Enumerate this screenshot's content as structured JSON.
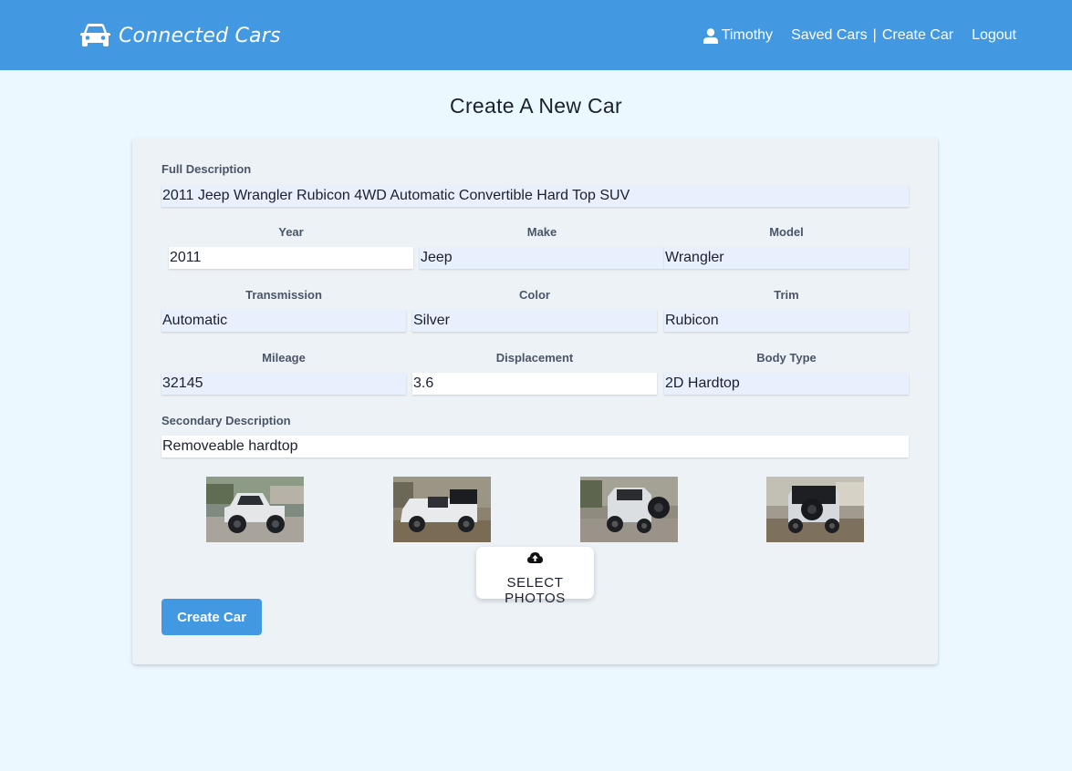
{
  "nav": {
    "brand": "Connected Cars",
    "user": "Timothy",
    "saved_cars": "Saved Cars",
    "separator": "|",
    "create_car": "Create Car",
    "logout": "Logout"
  },
  "page_title": "Create A New Car",
  "form": {
    "full_description": {
      "label": "Full Description",
      "value": "2011 Jeep Wrangler Rubicon 4WD Automatic Convertible Hard Top SUV"
    },
    "year": {
      "label": "Year",
      "value": "2011"
    },
    "make": {
      "label": "Make",
      "value": "Jeep"
    },
    "model": {
      "label": "Model",
      "value": "Wrangler"
    },
    "transmission": {
      "label": "Transmission",
      "value": "Automatic"
    },
    "color": {
      "label": "Color",
      "value": "Silver"
    },
    "trim": {
      "label": "Trim",
      "value": "Rubicon"
    },
    "mileage": {
      "label": "Mileage",
      "value": "32145"
    },
    "displacement": {
      "label": "Displacement",
      "value": "3.6"
    },
    "body_type": {
      "label": "Body Type",
      "value": "2D Hardtop"
    },
    "secondary_description": {
      "label": "Secondary Description",
      "value": "Removeable hardtop"
    }
  },
  "photos": {
    "select_label": "SELECT PHOTOS",
    "upload_icon": "cloud-upload-icon",
    "thumbnails": [
      "jeep-front-left",
      "jeep-side",
      "jeep-rear-left",
      "jeep-rear-right"
    ]
  },
  "submit_label": "Create Car",
  "colors": {
    "navbar": "#4299e1",
    "background": "#ebf8ff",
    "card": "#edf2f7",
    "autofill": "#e8f0fe",
    "button": "#4299e1"
  }
}
